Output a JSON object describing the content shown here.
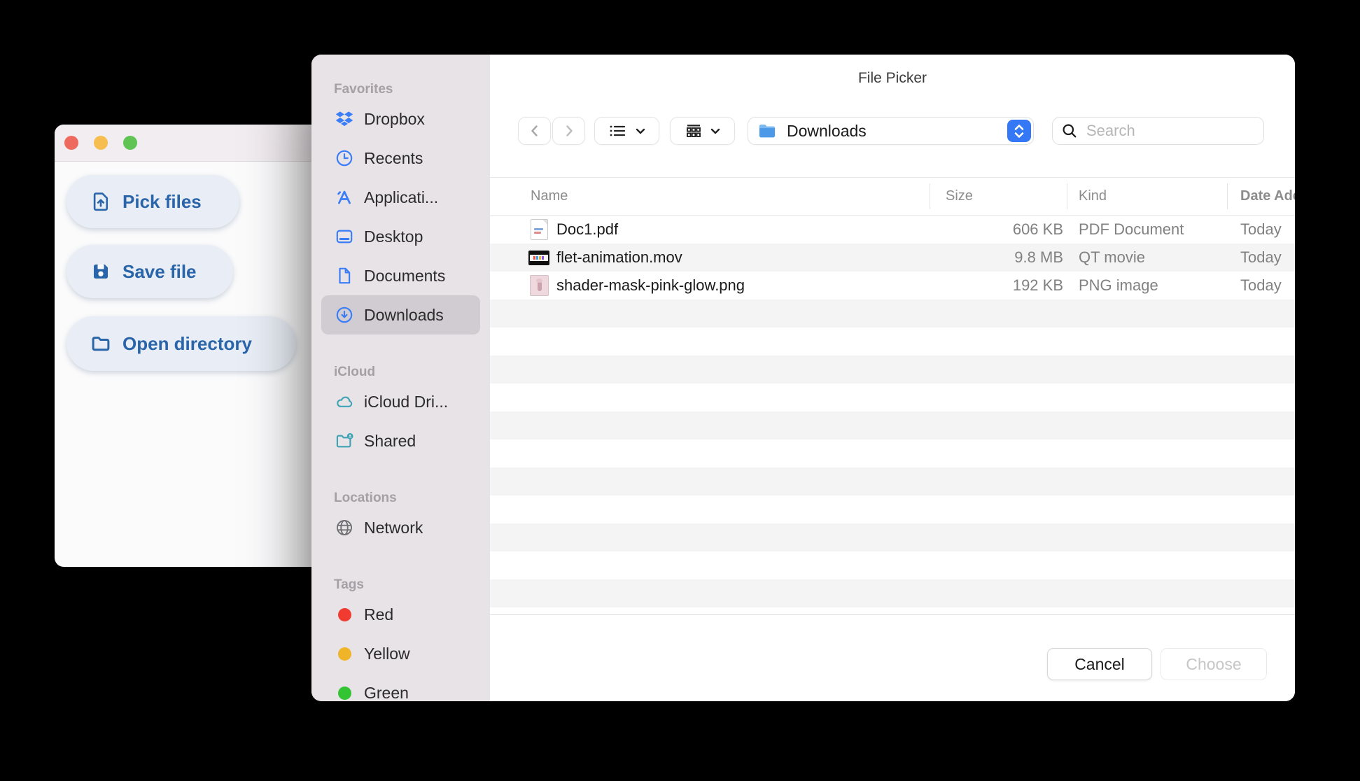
{
  "colors": {
    "accent_blue": "#3478F6",
    "icon_blue": "#3B7DF7",
    "icon_teal": "#3EA3B4",
    "app_button_bg": "#E9EEF6",
    "app_button_blue": "#2A64A9",
    "sidebar_bg": "#E8E3E7",
    "sidebar_selected": "#D1CCD2",
    "row_stripe": "#F5F4F5",
    "traffic_red": "#EE6A5E",
    "traffic_yellow": "#F5BE4F",
    "traffic_green": "#5FC454",
    "tag_red": "#F13B31",
    "tag_yellow": "#F0B429",
    "tag_green": "#32C433"
  },
  "app_window": {
    "buttons": {
      "pick": "Pick files",
      "save": "Save file",
      "open": "Open directory"
    }
  },
  "dialog": {
    "title": "File Picker",
    "sidebar": {
      "sections": [
        {
          "header": "Favorites",
          "items": [
            {
              "label": "Dropbox"
            },
            {
              "label": "Recents"
            },
            {
              "label": "Applicati..."
            },
            {
              "label": "Desktop"
            },
            {
              "label": "Documents"
            },
            {
              "label": "Downloads",
              "selected": true
            }
          ]
        },
        {
          "header": "iCloud",
          "items": [
            {
              "label": "iCloud Dri..."
            },
            {
              "label": "Shared"
            }
          ]
        },
        {
          "header": "Locations",
          "items": [
            {
              "label": "Network"
            }
          ]
        },
        {
          "header": "Tags",
          "items": [
            {
              "label": "Red"
            },
            {
              "label": "Yellow"
            },
            {
              "label": "Green"
            }
          ]
        }
      ]
    },
    "toolbar": {
      "path_label": "Downloads",
      "search_placeholder": "Search"
    },
    "table": {
      "columns": {
        "name": "Name",
        "size": "Size",
        "kind": "Kind",
        "date": "Date Added"
      },
      "rows": [
        {
          "name": "Doc1.pdf",
          "size": "606 KB",
          "kind": "PDF Document",
          "date": "Today"
        },
        {
          "name": "flet-animation.mov",
          "size": "9.8 MB",
          "kind": "QT movie",
          "date": "Today"
        },
        {
          "name": "shader-mask-pink-glow.png",
          "size": "192 KB",
          "kind": "PNG image",
          "date": "Today"
        }
      ]
    },
    "footer": {
      "cancel": "Cancel",
      "choose": "Choose"
    }
  }
}
